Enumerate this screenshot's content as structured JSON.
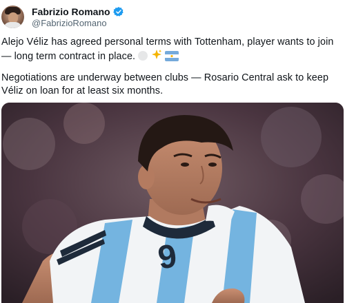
{
  "author": {
    "name": "Fabrizio Romano",
    "handle": "@FabrizioRomano"
  },
  "tweet": {
    "paragraph1": "Alejo Véliz has agreed personal terms with Tottenham, player wants to join — long term contract in place.",
    "paragraph2": "Negotiations are underway between clubs — Rosario Central ask to keep Véliz on loan for at least six months.",
    "emojis": [
      "white-circle",
      "sparkles",
      "argentina-flag"
    ]
  },
  "media": {
    "jersey_number": "9"
  },
  "colors": {
    "verified": "#1d9bf0",
    "handle": "#536471",
    "jersey_blue": "#74b4e0"
  }
}
